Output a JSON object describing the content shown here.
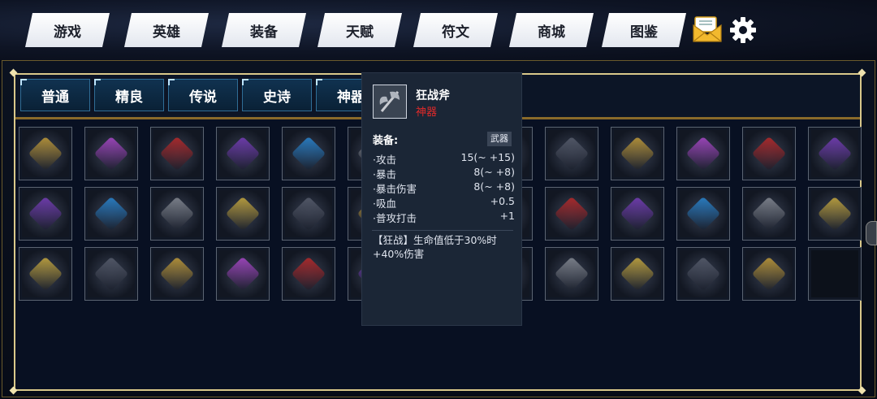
{
  "nav": {
    "items": [
      "游戏",
      "英雄",
      "装备",
      "天赋",
      "符文",
      "商城",
      "图鉴"
    ]
  },
  "header_icons": [
    "mail-envelope-icon",
    "settings-gear-icon"
  ],
  "tabs": [
    "普通",
    "精良",
    "传说",
    "史诗",
    "神器"
  ],
  "grid": {
    "rows": [
      [
        "golden-spellbook",
        "golden-ring",
        "crimson-amulet",
        "purple-bow",
        "purple-dagger",
        "crimson-item",
        "gold-item",
        "battle-axe",
        "silver-bracer",
        "blue-flame-boots",
        "purple-crystal",
        "crystal-staff"
      ],
      [
        "star-scepter",
        "purple-robe",
        "crimson-armor",
        "golden-crown",
        "purple-boots",
        "golden-item",
        "dark-item",
        "dark-eye-armor",
        "clawed-gauntlet",
        "golden-axe",
        "witch-hat",
        "purple-helm"
      ],
      [
        "horned-helm",
        "dark-shield",
        "flame-boots",
        "shadow-cloak",
        "amethyst-necklace",
        "blue-item",
        "red-item",
        "crossbow",
        "twin-blades",
        "silver-chestplate",
        "crimson-boots",
        "empty-slot"
      ]
    ]
  },
  "tooltip": {
    "name": "狂战斧",
    "rarity": "神器",
    "equip_label": "装备:",
    "type": "武器",
    "stats": [
      {
        "label": "·攻击",
        "value": "15(~ +15)"
      },
      {
        "label": "·暴击",
        "value": "8(~ +8)"
      },
      {
        "label": "·暴击伤害",
        "value": "8(~ +8)"
      },
      {
        "label": "·吸血",
        "value": "+0.5"
      },
      {
        "label": "·普攻打击",
        "value": "+1"
      }
    ],
    "desc": "【狂战】生命值低于30%时+40%伤害"
  },
  "colors": {
    "accent_gold": "#d9c88a",
    "rarity_red": "#e02a2a",
    "tab_blue": "#2f6d96"
  }
}
